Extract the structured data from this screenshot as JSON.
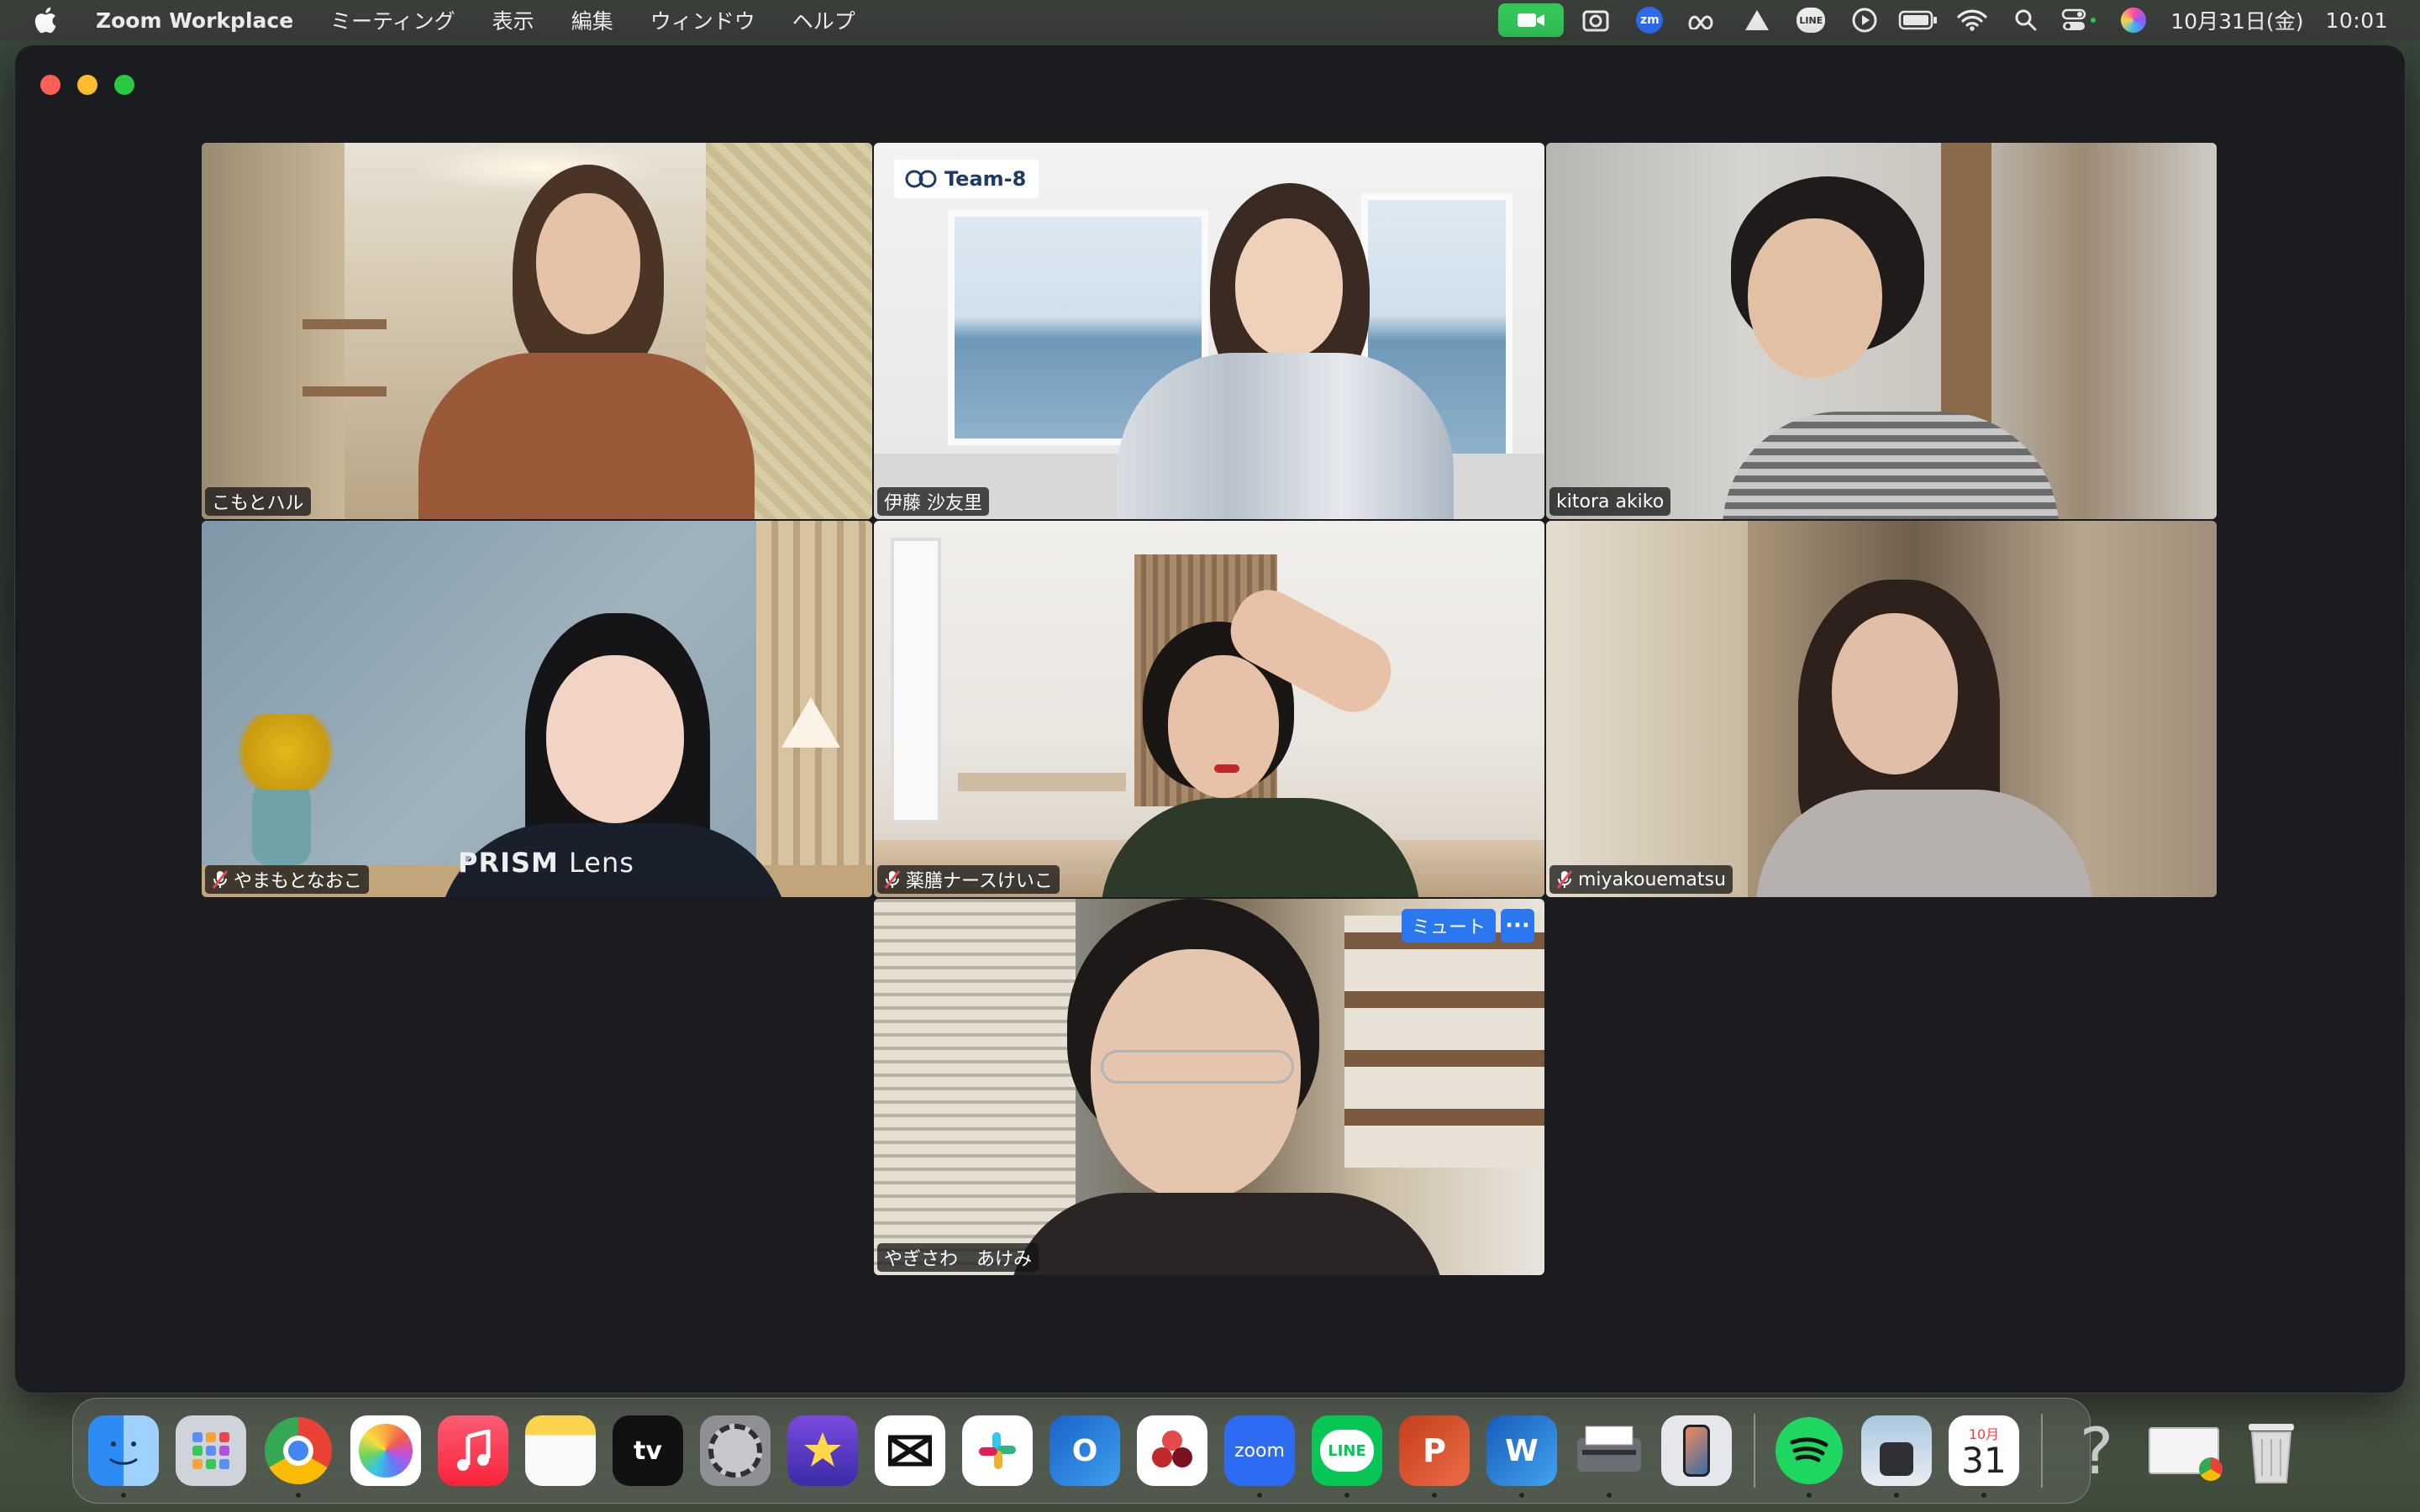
{
  "menubar": {
    "app_name": "Zoom Workplace",
    "menus": [
      "ミーティング",
      "表示",
      "編集",
      "ウィンドウ",
      "ヘルプ"
    ],
    "status_icons": [
      "video-camera-icon",
      "screen-record-icon",
      "zoom-icon",
      "meta-icon",
      "drive-icon",
      "line-icon",
      "play-icon",
      "battery-icon",
      "wifi-icon",
      "search-icon",
      "control-center-icon",
      "siri-icon"
    ],
    "zoom_label": "zm",
    "line_label": "LINE",
    "date": "10月31日(金)",
    "time": "10:01"
  },
  "participants": [
    {
      "name": "こもとハル",
      "muted": false,
      "active": false
    },
    {
      "name": "伊藤 沙友里",
      "muted": false,
      "active": true,
      "logo": "Team-8"
    },
    {
      "name": "kitora akiko",
      "muted": false,
      "active": false
    },
    {
      "name": "やまもとなおこ",
      "muted": true,
      "active": false,
      "shirt_text_bold": "PRISM",
      "shirt_text": "Lens"
    },
    {
      "name": "薬膳ナースけいこ",
      "muted": true,
      "active": false
    },
    {
      "name": "miyakouematsu",
      "muted": true,
      "active": false
    },
    {
      "name": "やぎさわ　あけみ",
      "muted": false,
      "active": false,
      "hover_mute_label": "ミュート",
      "hover_more_label": "···"
    }
  ],
  "dock": {
    "apps": [
      "Finder",
      "Launchpad",
      "Chrome",
      "Photos",
      "Music",
      "Notes",
      "TV",
      "System Settings",
      "iMovie",
      "CapCut",
      "Slack",
      "Outlook",
      "Photo Booth",
      "Zoom",
      "LINE",
      "PowerPoint",
      "Word",
      "Preview",
      "iPhone Mirroring",
      "Spotify",
      "Preview Image",
      "Calendar",
      "Help",
      "Chrome Window",
      "Trash"
    ],
    "tv_label": "tv",
    "zoom_label": "zoom",
    "line_label": "LINE",
    "ppt_label": "P",
    "word_label": "W",
    "outlook_label": "O",
    "calendar_month": "10月",
    "calendar_day": "31",
    "help_label": "?"
  },
  "colors": {
    "active_speaker_border": "#2ea84a",
    "hover_button": "#2b77f0",
    "window_bg": "#1b1c20"
  }
}
